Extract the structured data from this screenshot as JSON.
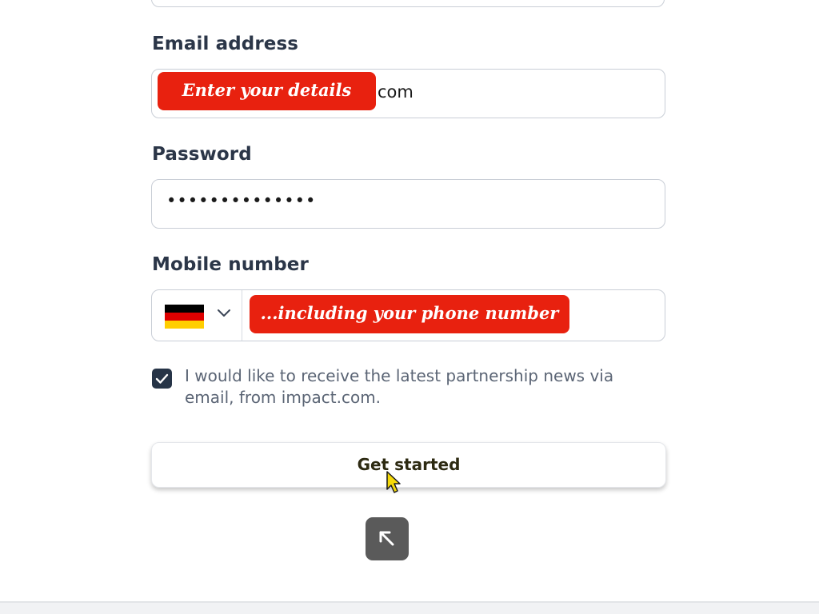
{
  "form": {
    "email": {
      "label": "Email address",
      "value": "com"
    },
    "password": {
      "label": "Password",
      "value": "••••••••••••••"
    },
    "mobile": {
      "label": "Mobile number",
      "country_flag": "germany-flag-icon",
      "flag_colors": [
        "#000000",
        "#dd0000",
        "#ffce00"
      ]
    },
    "newsletter": {
      "checked": true,
      "label": " I would like to receive the latest partnership news via email, from impact.com."
    },
    "submit_label": "Get started"
  },
  "annotations": {
    "email_note": "Enter your details",
    "phone_note": "...including your phone number"
  },
  "icons": {
    "back_to_top": "arrow-up-left-icon",
    "cursor": "pointer-cursor-icon",
    "chevron": "chevron-down-icon",
    "check": "checkmark-icon"
  },
  "colors": {
    "annotation_bg": "#e8210f",
    "checkbox_bg": "#263447",
    "back_to_top_bg": "#5a5a5a",
    "cursor_fill": "#f5d90a"
  }
}
